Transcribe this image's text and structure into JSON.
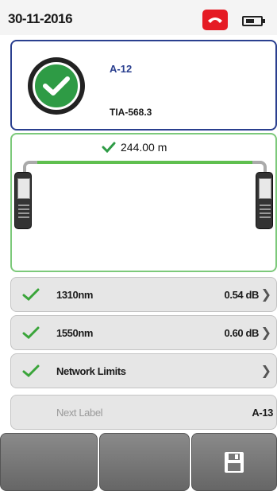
{
  "status_bar": {
    "date": "30-11-2016",
    "phone_icon": "hang-up-icon",
    "battery_icon": "battery-icon"
  },
  "result": {
    "status_icon": "check-circle-icon",
    "cable_id": "A-12",
    "standard": "TIA-568.3"
  },
  "diagram": {
    "length": "244.00 m"
  },
  "measurements": [
    {
      "label": "1310nm",
      "value": "0.54 dB"
    },
    {
      "label": "1550nm",
      "value": "0.60 dB"
    },
    {
      "label": "Network Limits",
      "value": ""
    }
  ],
  "next_label": {
    "label": "Next Label",
    "value": "A-13"
  },
  "softkeys": [
    {
      "label": ""
    },
    {
      "label": ""
    },
    {
      "icon": "save-icon"
    }
  ],
  "colors": {
    "pass_green": "#2e9b45",
    "accent_blue": "#2a3f8f",
    "alert_red": "#e51b24"
  }
}
